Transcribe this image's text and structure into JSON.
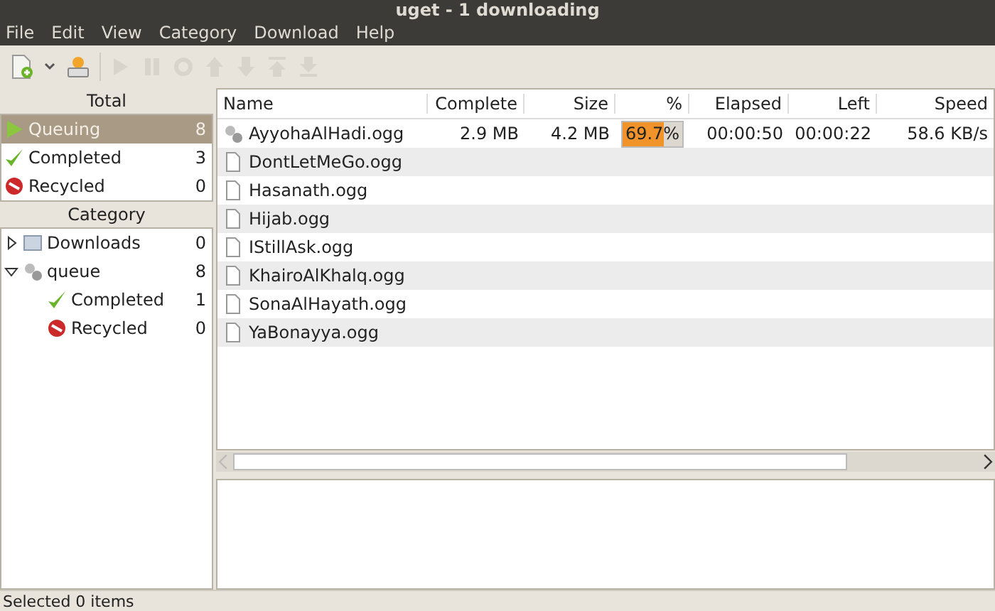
{
  "window": {
    "title": "uget - 1 downloading"
  },
  "menu": [
    "File",
    "Edit",
    "View",
    "Category",
    "Download",
    "Help"
  ],
  "sidebar": {
    "total_heading": "Total",
    "total_items": [
      {
        "label": "Queuing",
        "count": "8",
        "kind": "queuing",
        "selected": true
      },
      {
        "label": "Completed",
        "count": "3",
        "kind": "completed",
        "selected": false
      },
      {
        "label": "Recycled",
        "count": "0",
        "kind": "recycled",
        "selected": false
      }
    ],
    "category_heading": "Category",
    "categories": [
      {
        "label": "Downloads",
        "count": "0",
        "kind": "folder",
        "expanded": false
      },
      {
        "label": "queue",
        "count": "8",
        "kind": "queue",
        "expanded": true,
        "children": [
          {
            "label": "Completed",
            "count": "1",
            "kind": "completed"
          },
          {
            "label": "Recycled",
            "count": "0",
            "kind": "recycled"
          }
        ]
      }
    ]
  },
  "table": {
    "columns": [
      "Name",
      "Complete",
      "Size",
      "%",
      "Elapsed",
      "Left",
      "Speed"
    ],
    "rows": [
      {
        "name": "AyyohaAlHadi.ogg",
        "kind": "active",
        "complete": "2.9 MB",
        "size": "4.2 MB",
        "percent": "69.7%",
        "level": 0.697,
        "elapsed": "00:00:50",
        "left": "00:00:22",
        "speed": "58.6 KB/s"
      },
      {
        "name": "DontLetMeGo.ogg",
        "kind": "file"
      },
      {
        "name": "Hasanath.ogg",
        "kind": "file"
      },
      {
        "name": "Hijab.ogg",
        "kind": "file"
      },
      {
        "name": "IStillAsk.ogg",
        "kind": "file"
      },
      {
        "name": "KhairoAlKhalq.ogg",
        "kind": "file"
      },
      {
        "name": "SonaAlHayath.ogg",
        "kind": "file"
      },
      {
        "name": "YaBonayya.ogg",
        "kind": "file"
      }
    ]
  },
  "status_bar": "Selected 0 items"
}
